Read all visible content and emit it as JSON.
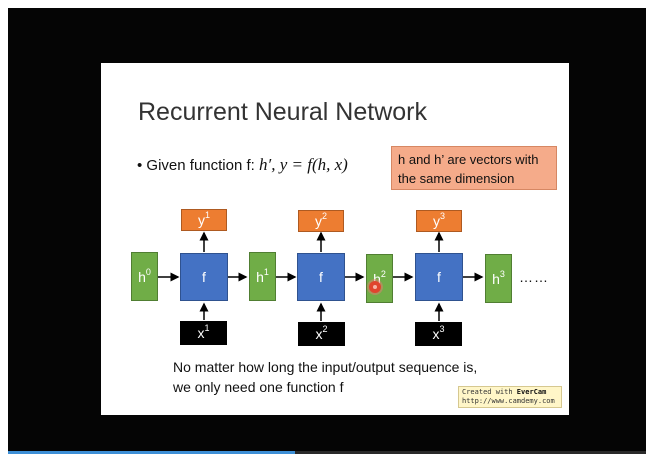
{
  "slide": {
    "title": "Recurrent Neural Network",
    "bullet_text": "Given function f: ",
    "bullet_formula": "h′, y = f(h, x)",
    "note": "h and h’ are vectors with the same dimension",
    "bottom_line1": "No matter how long the input/output sequence is,",
    "bottom_line2": "we only need one function f",
    "ellipsis": "……"
  },
  "diagram": {
    "f_label": "f",
    "hidden": [
      {
        "base": "h",
        "sup": "0"
      },
      {
        "base": "h",
        "sup": "1"
      },
      {
        "base": "h",
        "sup": "2"
      },
      {
        "base": "h",
        "sup": "3"
      }
    ],
    "outputs": [
      {
        "base": "y",
        "sup": "1"
      },
      {
        "base": "y",
        "sup": "2"
      },
      {
        "base": "y",
        "sup": "3"
      }
    ],
    "inputs": [
      {
        "base": "x",
        "sup": "1"
      },
      {
        "base": "x",
        "sup": "2"
      },
      {
        "base": "x",
        "sup": "3"
      }
    ]
  },
  "watermark": {
    "prefix": "Created with ",
    "brand": "EverCam",
    "url": "http://www.camdemy.com"
  },
  "player": {
    "progress_fraction": 0.45
  },
  "colors": {
    "hidden": "#70ad47",
    "function": "#4472c4",
    "output": "#ed7d31",
    "input": "#000000",
    "note_bg": "#f5ab8a"
  }
}
